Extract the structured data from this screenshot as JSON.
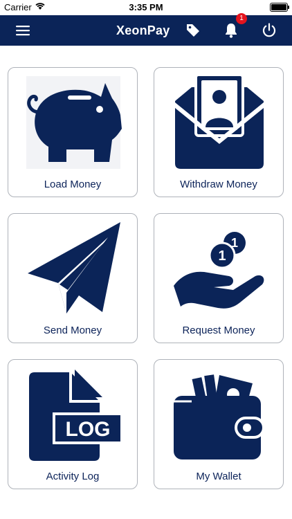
{
  "status_bar": {
    "carrier": "Carrier",
    "time": "3:35 PM"
  },
  "app_bar": {
    "title": "XeonPay",
    "notification_count": "1",
    "icons": [
      "menu-icon",
      "tag-icon",
      "bell-icon",
      "power-icon"
    ]
  },
  "tiles": [
    {
      "label": "Load Money",
      "icon": "piggy-bank-icon"
    },
    {
      "label": "Withdraw Money",
      "icon": "cash-envelope-icon"
    },
    {
      "label": "Send Money",
      "icon": "paper-plane-icon"
    },
    {
      "label": "Request Money",
      "icon": "hand-coins-icon"
    },
    {
      "label": "Activity Log",
      "icon": "log-file-icon"
    },
    {
      "label": "My Wallet",
      "icon": "wallet-icon"
    }
  ],
  "log_icon_text": "LOG",
  "colors": {
    "navy": "#0b2458",
    "badge_red": "#e3141e",
    "tile_border": "#aeb2b9"
  }
}
